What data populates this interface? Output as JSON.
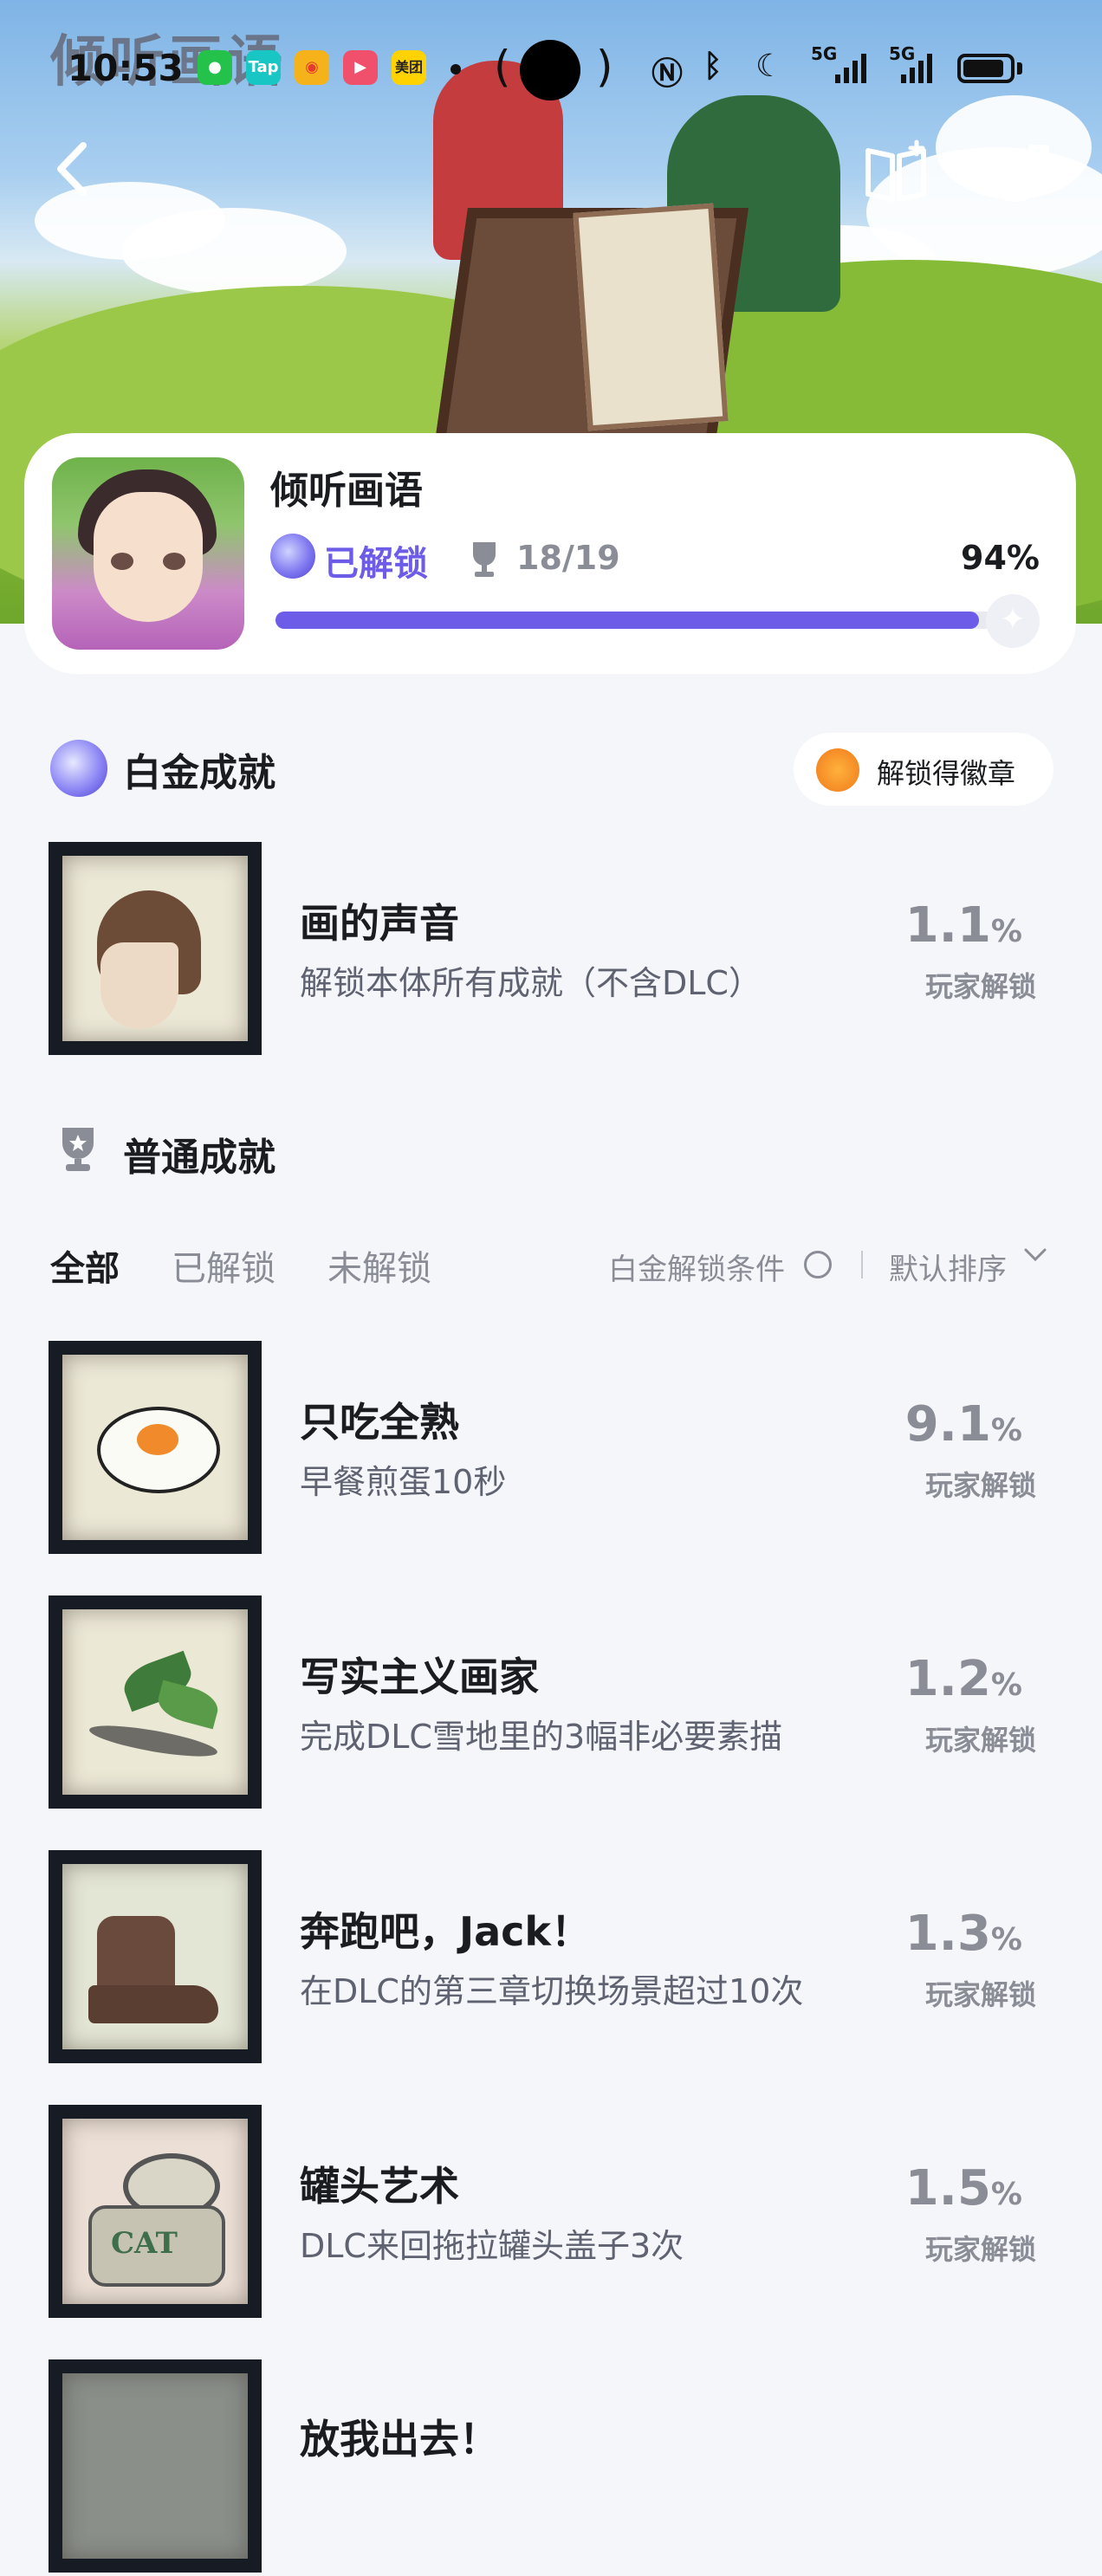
{
  "status_bar": {
    "time": "10:53",
    "app_icons": [
      "wechat-icon",
      "taptap-icon",
      "weibo-icon",
      "video-icon",
      "meituan-icon"
    ],
    "app_icon_labels": {
      "tap": "Tap",
      "meituan": "美团"
    },
    "network_labels": [
      "5G",
      "5G"
    ]
  },
  "hero": {
    "logo_text": "倾听画语"
  },
  "nav": {
    "back_icon": "back-arrow-icon",
    "book_icon": "book-plus-icon",
    "share_icon": "share-icon"
  },
  "game": {
    "title": "倾听画语",
    "unlocked_label": "已解锁",
    "unlock_count": "18/19",
    "percent_text": "94%",
    "progress_fraction": 0.94
  },
  "platinum": {
    "section_title": "白金成就",
    "badge_button_label": "解锁得徽章",
    "item": {
      "name": "画的声音",
      "desc": "解锁本体所有成就（不含DLC）",
      "rate": "1.1",
      "rate_unit": "%",
      "rate_label": "玩家解锁"
    }
  },
  "normal": {
    "section_title": "普通成就",
    "tabs": [
      "全部",
      "已解锁",
      "未解锁"
    ],
    "active_tab": "全部",
    "filter_condition": "白金解锁条件",
    "sort_label": "默认排序",
    "items": [
      {
        "name": "只吃全熟",
        "desc": "早餐煎蛋10秒",
        "rate": "9.1",
        "unit": "%",
        "label": "玩家解锁"
      },
      {
        "name": "写实主义画家",
        "desc": "完成DLC雪地里的3幅非必要素描",
        "rate": "1.2",
        "unit": "%",
        "label": "玩家解锁"
      },
      {
        "name": "奔跑吧，Jack！",
        "desc": "在DLC的第三章切换场景超过10次",
        "rate": "1.3",
        "unit": "%",
        "label": "玩家解锁"
      },
      {
        "name": "罐头艺术",
        "desc": "DLC来回拖拉罐头盖子3次",
        "rate": "1.5",
        "unit": "%",
        "label": "玩家解锁",
        "art_text": "CAT"
      },
      {
        "name": "放我出去！",
        "desc": "",
        "rate": "",
        "unit": "",
        "label": ""
      }
    ]
  },
  "colors": {
    "accent": "#6c5ce7",
    "background": "#f4f6f9",
    "muted_text": "#8a8d96"
  }
}
